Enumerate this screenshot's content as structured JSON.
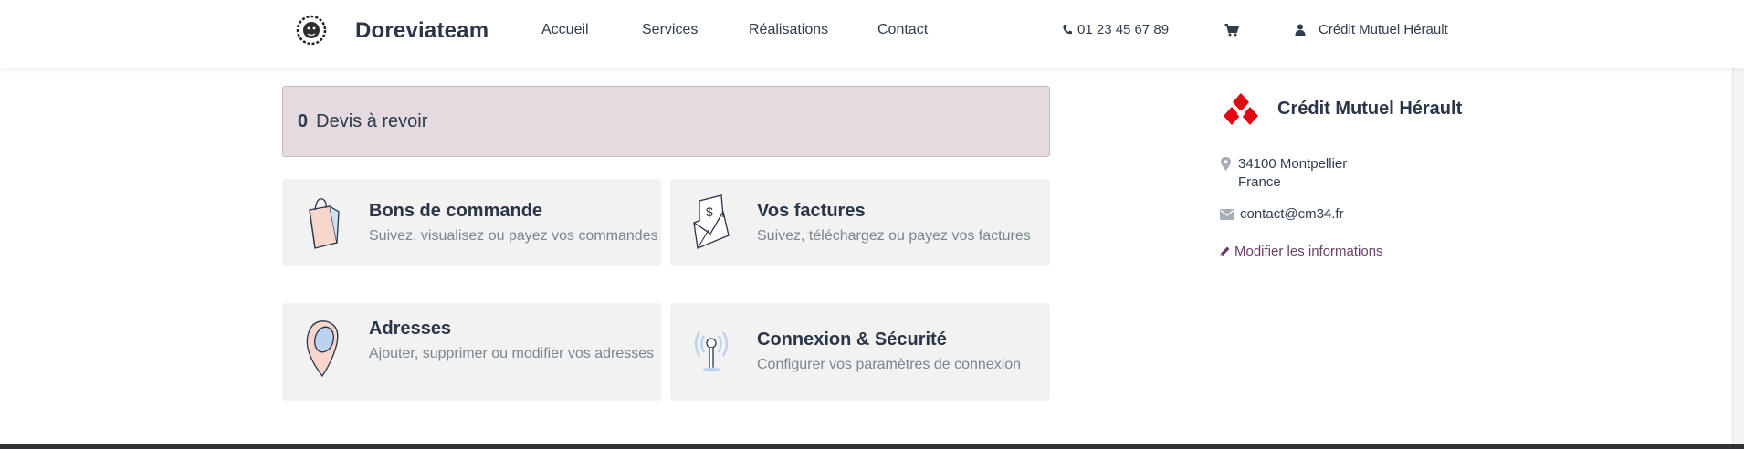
{
  "header": {
    "brand": "Doreviateam",
    "nav": [
      "Accueil",
      "Services",
      "Réalisations",
      "Contact"
    ],
    "phone": "01 23 45 67 89",
    "user_name": "Crédit Mutuel Hérault"
  },
  "quotes": {
    "count": "0",
    "label": "Devis à revoir"
  },
  "cards": {
    "orders": {
      "title": "Bons de commande",
      "desc": "Suivez, visualisez ou payez vos commandes"
    },
    "invoices": {
      "title": "Vos factures",
      "desc": "Suivez, téléchargez ou payez vos factures"
    },
    "addresses": {
      "title": "Adresses",
      "desc": "Ajouter, supprimer ou modifier vos adresses"
    },
    "security": {
      "title": "Connexion & Sécurité",
      "desc": "Configurer vos paramètres de connexion"
    }
  },
  "sidebar": {
    "company_name": "Crédit Mutuel Hérault",
    "address_line1": "34100 Montpellier",
    "address_line2": "France",
    "email": "contact@cm34.fr",
    "edit_label": "Modifier les informations"
  },
  "colors": {
    "quotes_bg": "#e4dadf",
    "card_bg": "#f2f2f2",
    "brand_red": "#e30613",
    "edit_link": "#6b3f6a"
  },
  "icons": {
    "logo": "lion-logo-icon",
    "phone": "phone-icon",
    "cart": "shopping-cart-icon",
    "user": "user-icon",
    "orders": "shopping-bag-icon",
    "invoices": "invoice-envelope-icon",
    "addresses": "map-pin-icon",
    "security": "signal-antenna-icon",
    "company": "credit-mutuel-logo-icon",
    "address": "map-marker-icon",
    "email": "envelope-icon",
    "edit": "pencil-icon"
  }
}
